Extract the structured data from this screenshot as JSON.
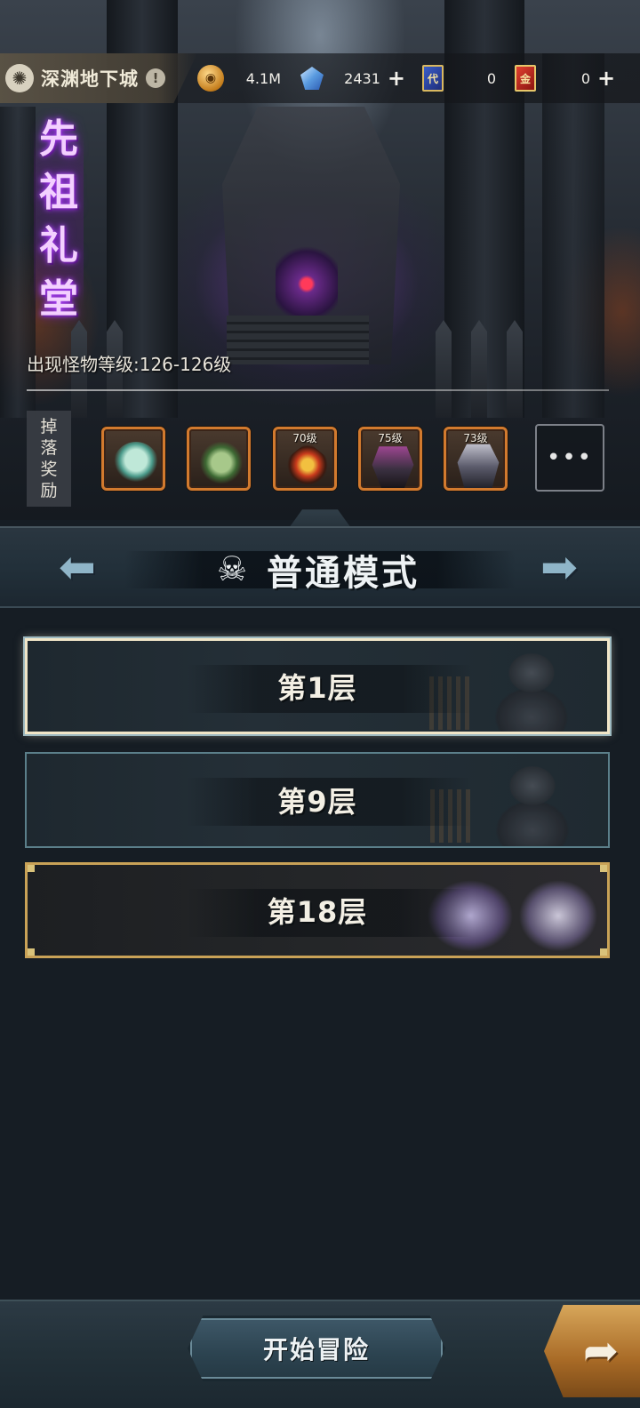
{
  "header": {
    "dungeon_icon": "swirl-icon",
    "dungeon_name": "深渊地下城",
    "info_symbol": "!"
  },
  "resources": [
    {
      "name": "gold",
      "icon": "coin-icon",
      "value": "4.1M",
      "has_plus": false
    },
    {
      "name": "crystal",
      "icon": "crystal-icon",
      "value": "2431",
      "has_plus": true,
      "plus": "+"
    },
    {
      "name": "blue-card",
      "icon": "blue-card-icon",
      "icon_text": "代",
      "value": "0",
      "has_plus": false
    },
    {
      "name": "red-card",
      "icon": "red-card-icon",
      "icon_text": "金",
      "value": "0",
      "has_plus": true,
      "plus": "+"
    }
  ],
  "stage": {
    "title_chars": [
      "先",
      "祖",
      "礼",
      "堂"
    ],
    "monster_level": "出现怪物等级:126-126级"
  },
  "drops": {
    "label_chars": [
      "掉",
      "落",
      "奖",
      "励"
    ],
    "items": [
      {
        "name": "hero-portrait-teal",
        "level": ""
      },
      {
        "name": "hero-portrait-green",
        "level": ""
      },
      {
        "name": "helmet",
        "level": "70级"
      },
      {
        "name": "armor",
        "level": "75级"
      },
      {
        "name": "armor-silver",
        "level": "73级"
      }
    ],
    "more": "•••"
  },
  "mode": {
    "icon": "skull-icon",
    "title": "普通模式",
    "prev_arrow": "prev-arrow-icon",
    "next_arrow": "next-arrow-icon"
  },
  "floors": [
    {
      "label": "第1层",
      "selected": true
    },
    {
      "label": "第9层",
      "selected": false
    },
    {
      "label": "第18层",
      "selected": false
    }
  ],
  "footer": {
    "start_label": "开始冒险",
    "share_icon": "share-arrow-icon"
  },
  "colors": {
    "accent_orange": "#d27a2e",
    "gold_border": "#c9a257",
    "selected_border": "#f1e6c8",
    "title_purple_glow": "#b54aff"
  }
}
